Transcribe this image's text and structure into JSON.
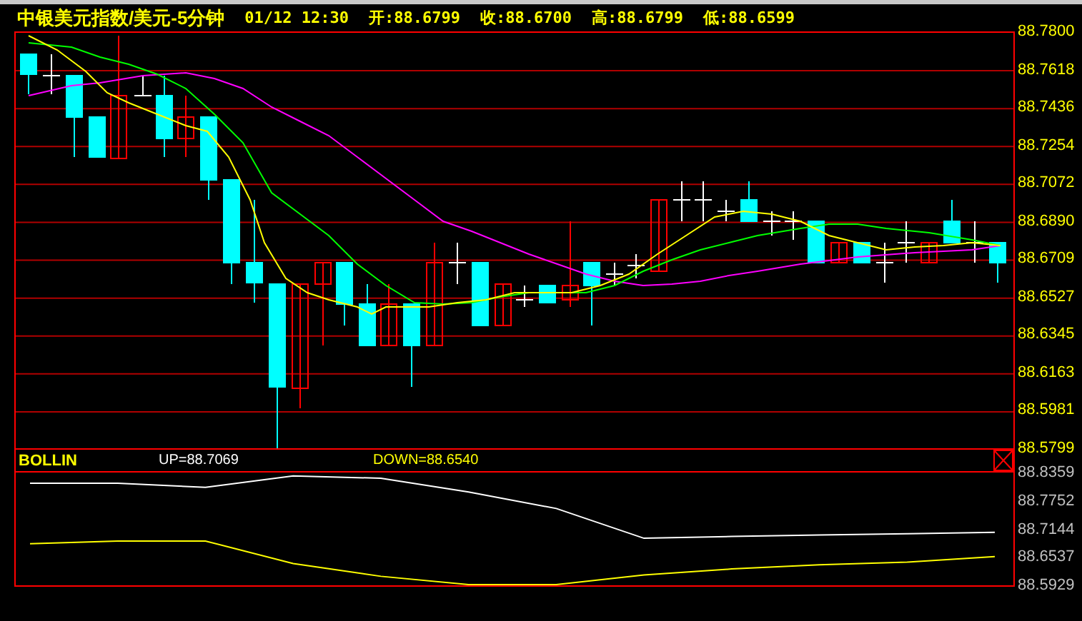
{
  "header": {
    "title": "中银美元指数/美元-5分钟",
    "time": "01/12 12:30",
    "open": "开:88.6799",
    "close": "收:88.6700",
    "high": "高:88.6799",
    "low": "低:88.6599"
  },
  "price_axis": {
    "ticks": [
      "88.7800",
      "88.7618",
      "88.7436",
      "88.7254",
      "88.7072",
      "88.6890",
      "88.6709",
      "88.6527",
      "88.6345",
      "88.6163",
      "88.5981",
      "88.5799"
    ]
  },
  "indicator": {
    "name": "BOLLIN",
    "up": "UP=88.7069",
    "down": "DOWN=88.6540",
    "chart_data": {
      "type": "line",
      "ylim": [
        88.5929,
        88.8359
      ],
      "yticks": [
        88.8359,
        88.7752,
        88.7144,
        88.6537,
        88.5929
      ],
      "series": [
        {
          "color": "#ffffff",
          "values": [
            88.814,
            88.814,
            88.805,
            88.83,
            88.825,
            88.795,
            88.759,
            88.694,
            88.698,
            88.701,
            88.704,
            88.707
          ]
        },
        {
          "color": "#ffff00",
          "values": [
            88.682,
            88.688,
            88.688,
            88.639,
            88.611,
            88.593,
            88.593,
            88.614,
            88.627,
            88.636,
            88.642,
            88.654
          ]
        }
      ]
    }
  }
}
